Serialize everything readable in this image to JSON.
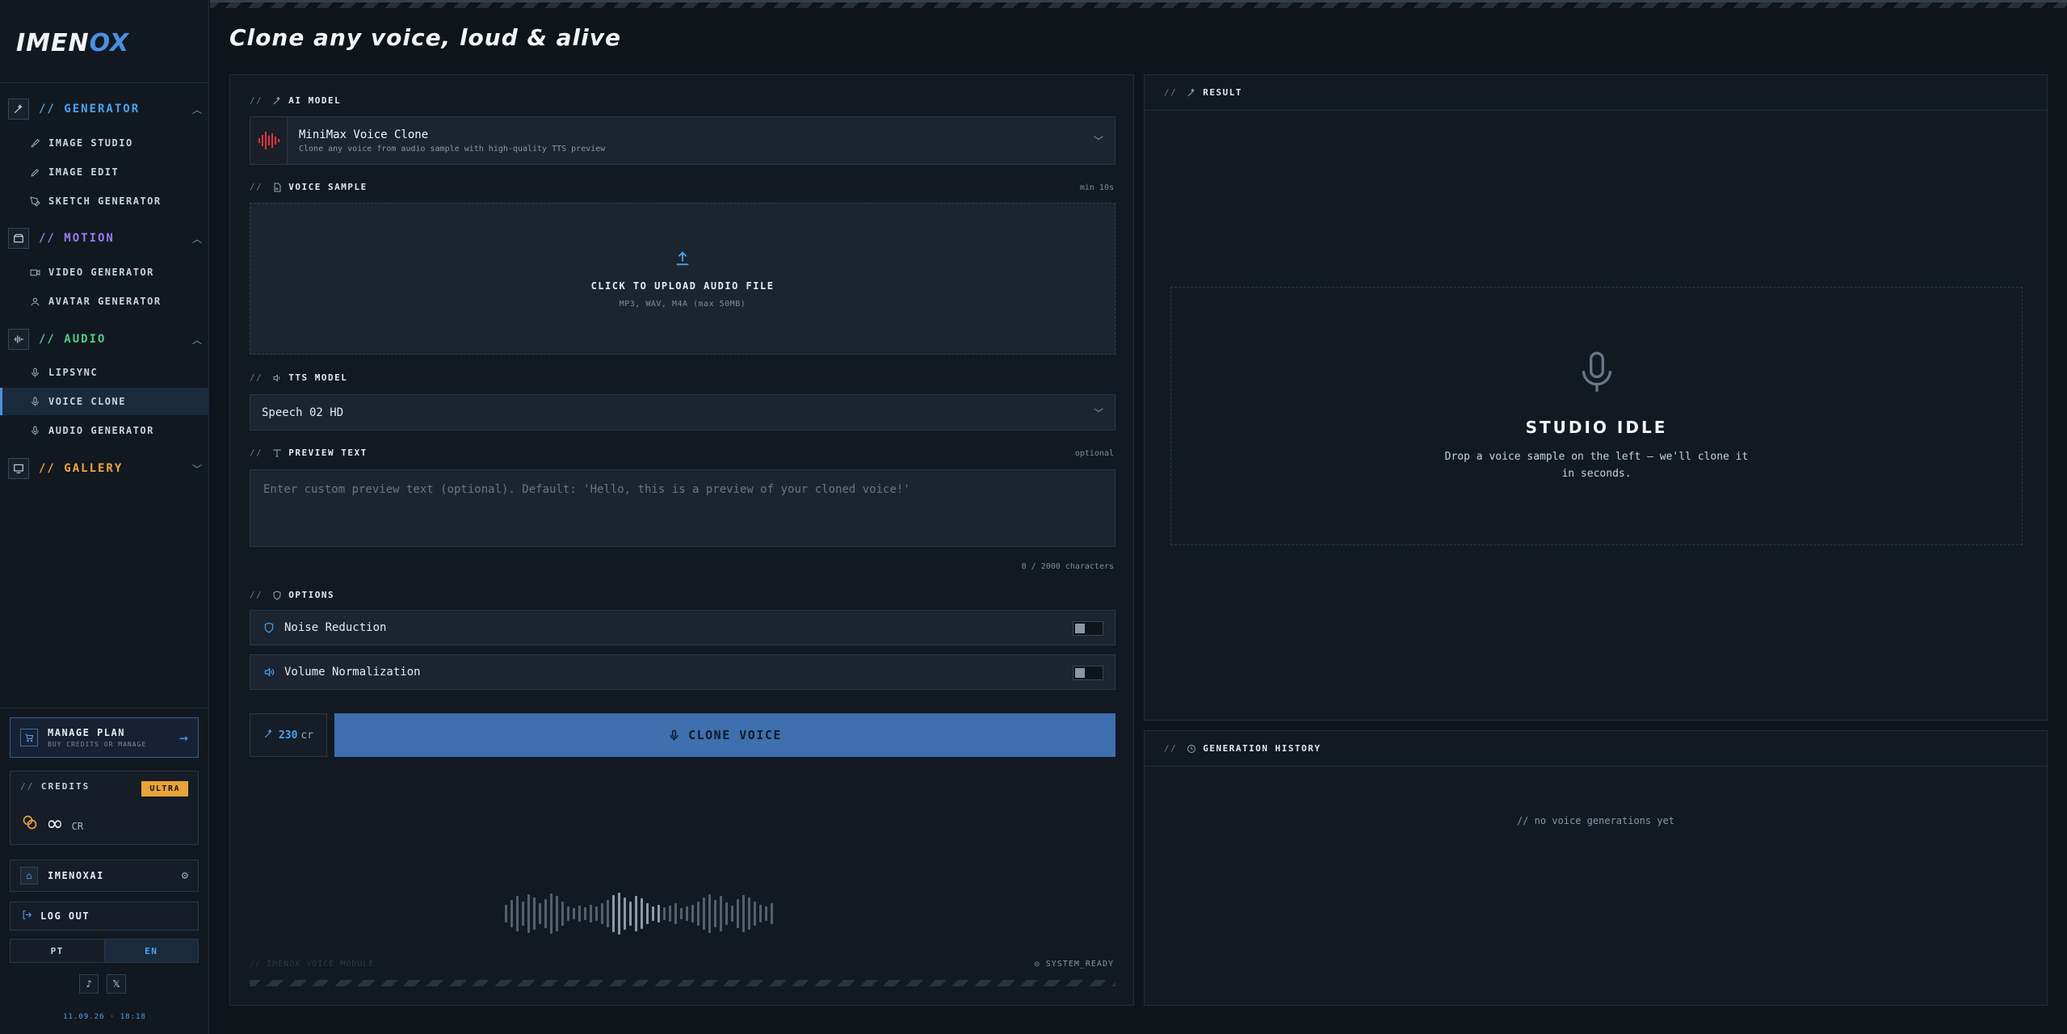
{
  "sidebar": {
    "logo_main": "IMEN",
    "logo_accent": "OX",
    "sections": {
      "generator": "// GENERATOR",
      "motion": "// MOTION",
      "audio": "// AUDIO",
      "gallery": "// GALLERY"
    },
    "items": {
      "image_studio": "IMAGE STUDIO",
      "image_edit": "IMAGE EDIT",
      "sketch_generator": "SKETCH GENERATOR",
      "video_generator": "VIDEO GENERATOR",
      "avatar_generator": "AVATAR GENERATOR",
      "lipsync": "LIPSYNC",
      "voice_clone": "VOICE CLONE",
      "audio_generator": "AUDIO GENERATOR"
    },
    "manage_plan": {
      "title": "MANAGE PLAN",
      "subtitle": "BUY CREDITS OR MANAGE"
    },
    "credits": {
      "label": "CREDITS",
      "slashes": "//",
      "badge": "ULTRA",
      "value": "∞",
      "unit": "CR"
    },
    "user": {
      "name": "IMENOXAI"
    },
    "logout": "LOG OUT",
    "lang": {
      "pt": "PT",
      "en": "EN"
    },
    "timestamp": "11.09.26 · 18:18"
  },
  "main": {
    "title": "Clone any voice, loud & alive",
    "slashes": "//",
    "ai_model": {
      "label": "AI MODEL",
      "name": "MiniMax Voice Clone",
      "description": "Clone any voice from audio sample with high-quality TTS preview"
    },
    "voice_sample": {
      "label": "VOICE SAMPLE",
      "note": "min 10s",
      "upload_title": "CLICK TO UPLOAD AUDIO FILE",
      "upload_formats": "MP3, WAV, M4A (max 50MB)"
    },
    "tts_model": {
      "label": "TTS MODEL",
      "value": "Speech 02 HD"
    },
    "preview_text": {
      "label": "PREVIEW TEXT",
      "note": "optional",
      "placeholder": "Enter custom preview text (optional). Default: 'Hello, this is a preview of your cloned voice!'",
      "char_count": "0 / 2000 characters"
    },
    "options": {
      "label": "OPTIONS",
      "noise_reduction": "Noise Reduction",
      "volume_normalization": "Volume Normalization"
    },
    "cost": {
      "value": "230",
      "unit": "cr"
    },
    "clone_button": "CLONE VOICE",
    "footer_left": "// IMENOX_VOICE_MODULE",
    "footer_right": "◎ SYSTEM_READY"
  },
  "result": {
    "label": "RESULT",
    "idle_title": "STUDIO IDLE",
    "idle_subtitle": "Drop a voice sample on the left — we'll clone it in seconds."
  },
  "history": {
    "label": "GENERATION HISTORY",
    "empty": "// no voice generations yet"
  },
  "colors": {
    "accent": "#4a90e2",
    "generator": "#4aa3f0",
    "motion": "#9b7cf2",
    "audio": "#4bd08a",
    "gallery": "#f0a640",
    "ultra_badge": "#e8a33a",
    "clone_button": "#3e6fae"
  }
}
